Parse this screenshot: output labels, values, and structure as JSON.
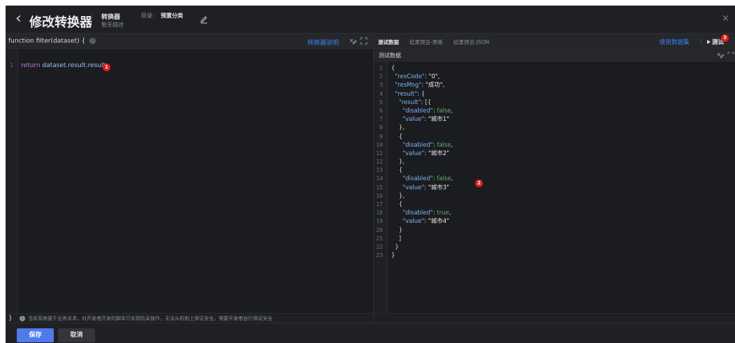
{
  "header": {
    "back_glyph": "‹",
    "title": "修改转换器",
    "converter_name": "转换器",
    "converter_desc": "暂无描述",
    "directory_label": "目录:",
    "directory_value": "预置分类",
    "close_glyph": "×"
  },
  "left": {
    "function_signature": "function filter(dataset) {",
    "help_glyph": "?",
    "converter_help_link": "转换器说明",
    "code_lines": [
      {
        "num": "1",
        "keyword": "return",
        "text": " dataset.result.result"
      }
    ],
    "closing_brace": "}",
    "info_glyph": "i",
    "notice": "当前系统基于业务诉求，对开发者开发的脚本只实现防呆操作，无法从机制上保证安全，需要开发者自行保证安全"
  },
  "right": {
    "tabs": [
      {
        "label": "测试数据",
        "active": true
      },
      {
        "label": "结果预览-表格",
        "active": false
      },
      {
        "label": "结果预览-JSON",
        "active": false
      }
    ],
    "use_dataset": "使用数据集",
    "test_button": "测试",
    "subtitle": "测试数据",
    "json_lines": [
      "{",
      "  \"resCode\": \"0\",",
      "  \"resMsg\": \"成功\",",
      "  \"result\": {",
      "    \"result\": [{",
      "      \"disabled\": false,",
      "      \"value\": \"城市1\"",
      "    },",
      "    {",
      "      \"disabled\": false,",
      "      \"value\": \"城市2\"",
      "    },",
      "    {",
      "      \"disabled\": false,",
      "      \"value\": \"城市3\"",
      "    },",
      "    {",
      "      \"disabled\": true,",
      "      \"value\": \"城市4\"",
      "    }",
      "    ]",
      "  }",
      "}"
    ]
  },
  "badges": {
    "one": "1",
    "two": "2",
    "three": "3"
  },
  "footer": {
    "save_label": "保存",
    "cancel_label": "取消"
  },
  "colors": {
    "accent": "#4f7bea",
    "link": "#3b82f6",
    "badge": "#e11d1d",
    "keyword": "#c678dd",
    "json_key": "#7fb4f5",
    "json_bool": "#57b36a"
  }
}
